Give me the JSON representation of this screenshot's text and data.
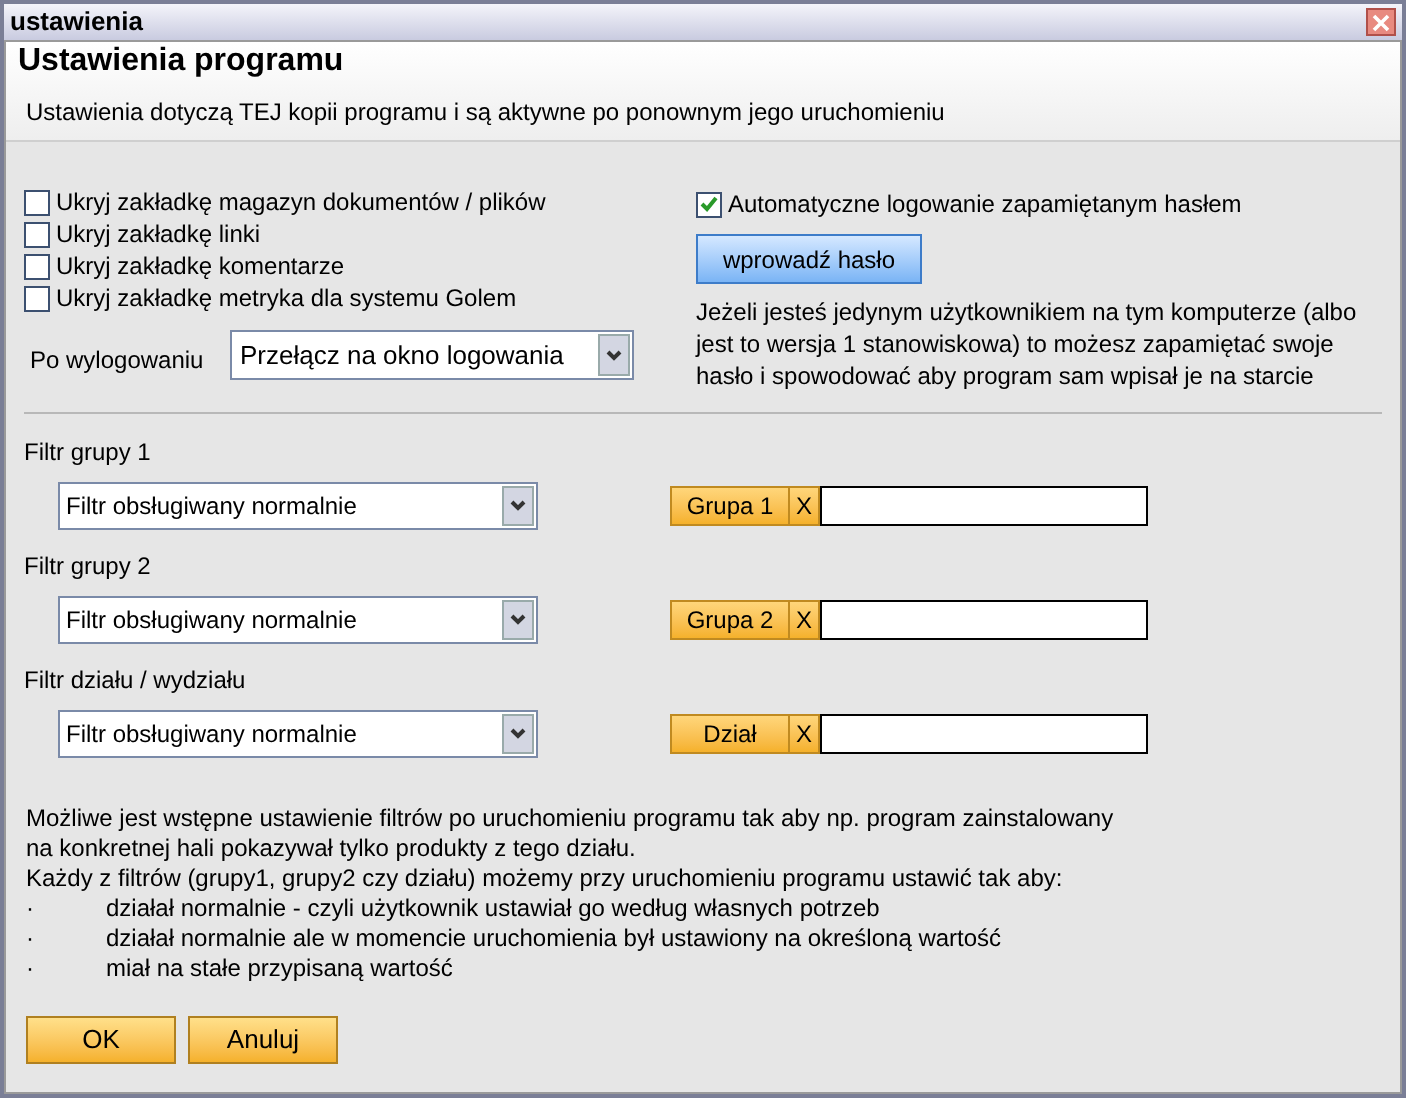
{
  "window": {
    "title": "ustawienia"
  },
  "header": {
    "title": "Ustawienia programu",
    "subtitle": "Ustawienia dotyczą TEJ kopii programu i są aktywne po ponownym jego uruchomieniu"
  },
  "hide_options": [
    {
      "label": "Ukryj zakładkę magazyn dokumentów / plików",
      "checked": false
    },
    {
      "label": "Ukryj zakładkę linki",
      "checked": false
    },
    {
      "label": "Ukryj zakładkę komentarze",
      "checked": false
    },
    {
      "label": "Ukryj zakładkę metryka dla systemu Golem",
      "checked": false
    }
  ],
  "logout": {
    "label": "Po wylogowaniu",
    "value": "Przełącz na okno logowania"
  },
  "auto_login": {
    "label": "Automatyczne logowanie zapamiętanym hasłem",
    "checked": true
  },
  "password_button": "wprowadź hasło",
  "password_note": "Jeżeli jesteś jedynym użytkownikiem na tym komputerze (albo jest to wersja 1 stanowiskowa) to możesz zapamiętać swoje hasło i spowodować aby program sam wpisał je na starcie",
  "filters": [
    {
      "label": "Filtr grupy 1",
      "mode": "Filtr obsługiwany normalnie",
      "button": "Grupa 1",
      "clear": "X"
    },
    {
      "label": "Filtr grupy 2",
      "mode": "Filtr obsługiwany normalnie",
      "button": "Grupa 2",
      "clear": "X"
    },
    {
      "label": "Filtr działu / wydziału",
      "mode": "Filtr obsługiwany normalnie",
      "button": "Dział",
      "clear": "X"
    }
  ],
  "info": {
    "lines": [
      "Możliwe jest wstępne ustawienie filtrów po uruchomieniu programu tak aby np. program zainstalowany",
      "na konkretnej hali pokazywał tylko produkty z tego działu.",
      "Każdy z filtrów (grupy1, grupy2 czy działu) możemy przy uruchomieniu programu ustawić tak aby:"
    ],
    "bullets": [
      {
        "marker": "·",
        "text": "działał normalnie - czyli użytkownik ustawiał go według własnych potrzeb"
      },
      {
        "marker": "·",
        "text": "działał normalnie ale w momencie uruchomienia był ustawiony na określoną wartość"
      },
      {
        "marker": "·",
        "text": "miał na stałe przypisaną wartość"
      }
    ]
  },
  "buttons": [
    "OK",
    "Anuluj"
  ]
}
